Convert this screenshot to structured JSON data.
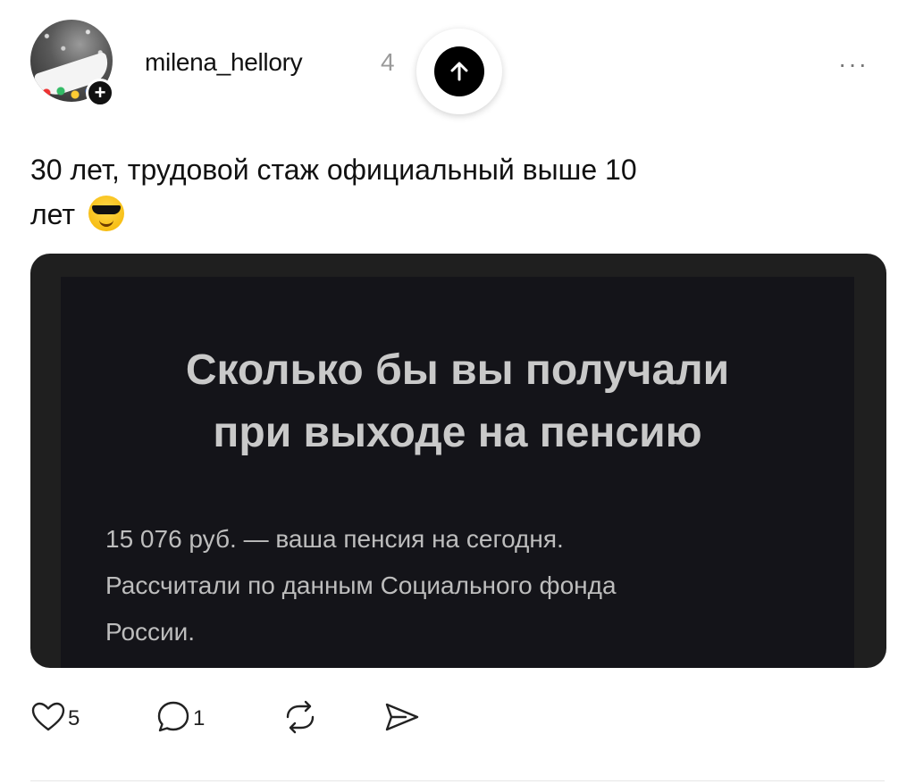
{
  "post": {
    "author": "milena_hellory",
    "time": "4",
    "follow_symbol": "+",
    "more_symbol": "···",
    "text_line1": "30 лет, трудовой стаж официальный выше 10",
    "text_line2": "лет"
  },
  "card": {
    "title_line1": "Сколько бы вы получали",
    "title_line2": "при выходе на пенсию",
    "body_line1": "15 076 руб. — ваша пенсия на сегодня.",
    "body_line2": "Рассчитали по данным Социального фонда",
    "body_line3": "России."
  },
  "actions": {
    "likes": "5",
    "comments": "1"
  },
  "icons": {
    "avatar": "avatar-image",
    "follow": "plus-icon",
    "scroll_up": "arrow-up-icon",
    "more": "more-dots-icon",
    "emoji": "sunglasses-emoji-icon",
    "like": "heart-icon",
    "comment": "comment-bubble-icon",
    "repost": "repost-icon",
    "share": "send-icon"
  }
}
